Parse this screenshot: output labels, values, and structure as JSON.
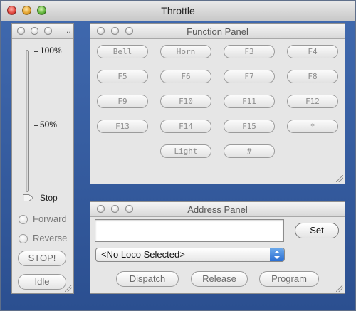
{
  "window": {
    "title": "Throttle"
  },
  "throttle_panel": {
    "ellipsis": "..",
    "ticks": {
      "top": "100%",
      "mid": "50%",
      "stop": "Stop"
    },
    "speed_fraction": 0.0,
    "forward_label": "Forward",
    "reverse_label": "Reverse",
    "stop_button": "STOP!",
    "idle_button": "Idle"
  },
  "function_panel": {
    "title": "Function Panel",
    "buttons": [
      "Bell",
      "Horn",
      "F3",
      "F4",
      "F5",
      "F6",
      "F7",
      "F8",
      "F9",
      "F10",
      "F11",
      "F12",
      "F13",
      "F14",
      "F15",
      "*",
      "Light",
      "#"
    ]
  },
  "address_panel": {
    "title": "Address Panel",
    "address_value": "",
    "set_button": "Set",
    "loco_select": "<No Loco Selected>",
    "dispatch_button": "Dispatch",
    "release_button": "Release",
    "program_button": "Program"
  },
  "colors": {
    "desktop": "#3a5ea0",
    "select_accent": "#2b6fd3"
  }
}
